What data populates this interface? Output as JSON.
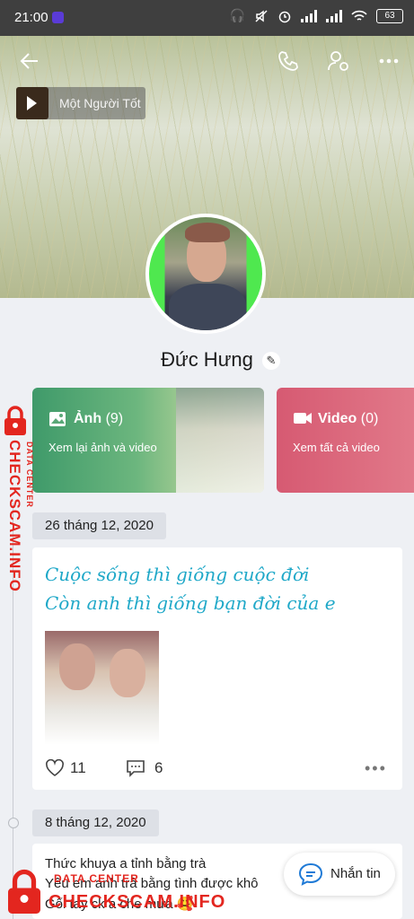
{
  "status_bar": {
    "time": "21:00",
    "battery": "63",
    "icons": [
      "headphones-icon",
      "mute-icon",
      "alarm-icon",
      "signal-icon",
      "signal-icon",
      "wifi-icon"
    ]
  },
  "header": {
    "back_icon": "back-arrow-icon",
    "call_icon": "phone-icon",
    "settings_icon": "user-settings-icon",
    "more_icon": "more-icon"
  },
  "music": {
    "title": "Một Người Tốt"
  },
  "profile": {
    "name": "Đức Hưng"
  },
  "media": {
    "photos": {
      "label": "Ảnh",
      "count": "(9)",
      "sub": "Xem lại ảnh và video"
    },
    "videos": {
      "label": "Video",
      "count": "(0)",
      "sub": "Xem tất cả video"
    }
  },
  "posts": [
    {
      "date": "26 tháng 12, 2020",
      "lines": [
        "Cuộc sống thì giống cuộc đời",
        "Còn anh thì giống bạn đời của e"
      ],
      "likes": "11",
      "comments": "6"
    },
    {
      "date": "8 tháng 12, 2020",
      "lines": [
        "Thức khuya a tỉnh bằng trà",
        "Yêu em anh trả bằng tình được khô",
        "Gối tay ck a che mưa 🥰"
      ]
    }
  ],
  "chat_button": {
    "label": "Nhắn tin"
  },
  "watermark": {
    "brand": "CHECKSCAM.INFO",
    "sub": "DATA CENTER"
  },
  "colors": {
    "photo_card": "#3f9a6a",
    "video_card": "#d65a72",
    "handwriting": "#1fa8c8",
    "watermark": "#e3261f"
  }
}
